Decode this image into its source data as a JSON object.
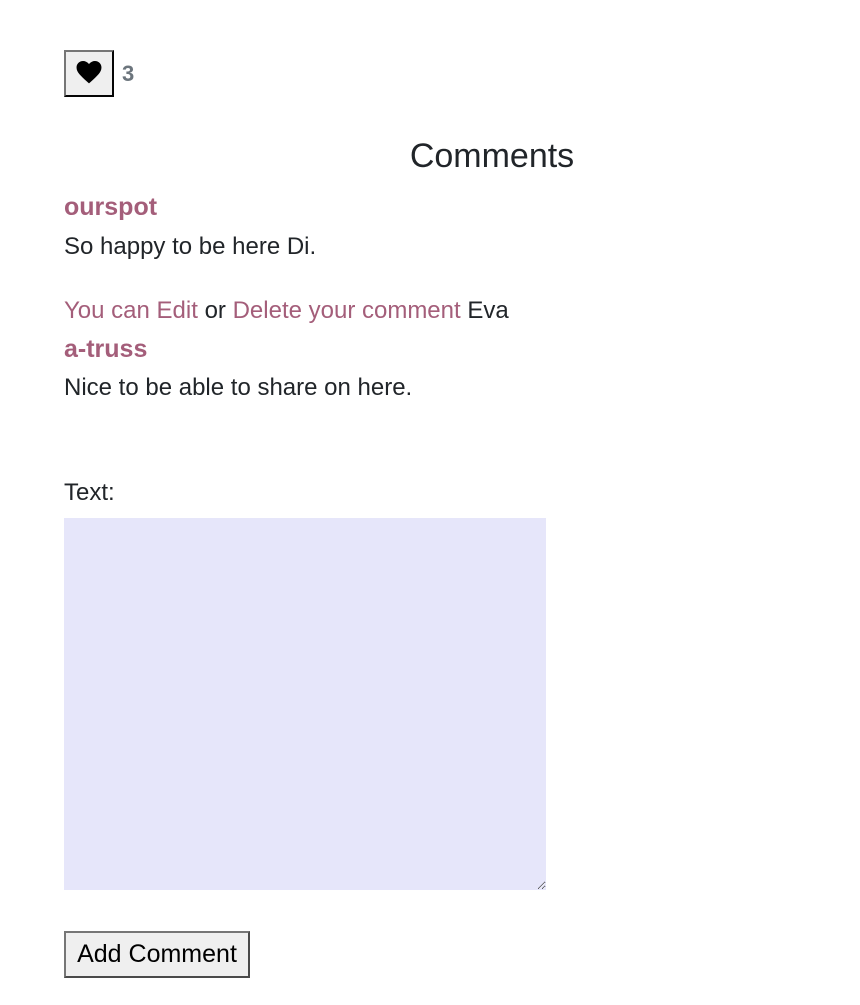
{
  "like": {
    "icon": "heart-icon",
    "count": "3"
  },
  "comments_section": {
    "title": "Comments",
    "comments": [
      {
        "author": "ourspot",
        "text": "So happy to be here Di."
      },
      {
        "author": "a-truss",
        "text": "Nice to be able to share on here."
      }
    ],
    "owner_actions": {
      "edit_link": "You can Edit",
      "separator": "or",
      "delete_link": "Delete your comment",
      "user_name": "Eva"
    }
  },
  "comment_form": {
    "label": "Text:",
    "textarea_value": "",
    "submit_label": "Add Comment"
  },
  "colors": {
    "accent": "#a45e7a",
    "textarea_bg": "#e6e6fa",
    "muted": "#6c757d"
  }
}
